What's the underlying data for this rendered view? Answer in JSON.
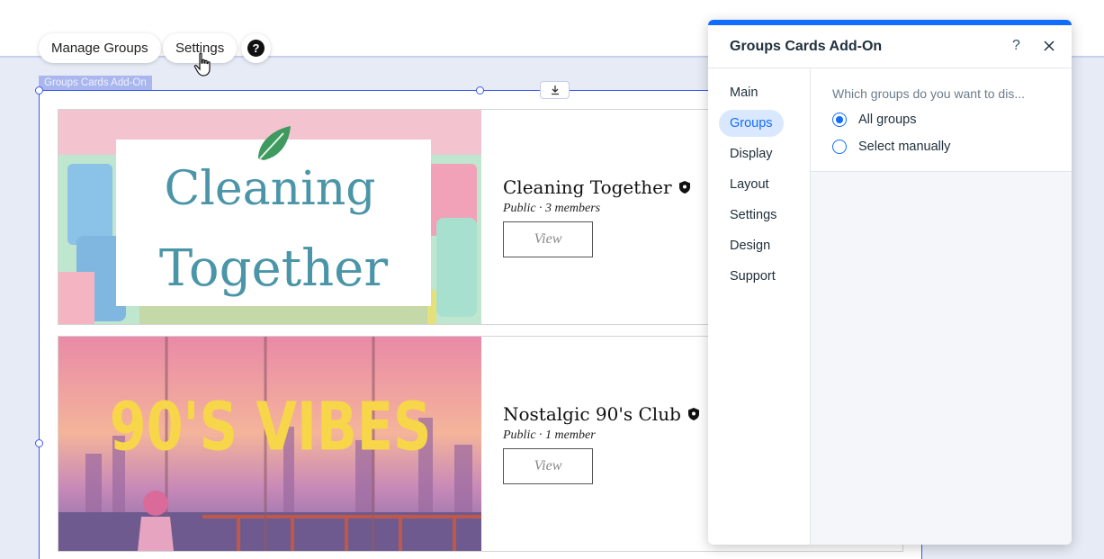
{
  "toolbar": {
    "manage_groups": "Manage Groups",
    "settings": "Settings",
    "help": "?"
  },
  "component": {
    "label": "Groups Cards Add-On"
  },
  "groups": [
    {
      "title": "Cleaning Together",
      "meta": "Public · 3 members",
      "view_label": "View",
      "image_text_line1": "Cleaning",
      "image_text_line2": "Together"
    },
    {
      "title": "Nostalgic 90's Club",
      "meta": "Public · 1 member",
      "view_label": "View",
      "image_text_line1": "90'S VIBES"
    }
  ],
  "panel": {
    "title": "Groups Cards Add-On",
    "help": "?",
    "nav": [
      "Main",
      "Groups",
      "Display",
      "Layout",
      "Settings",
      "Design",
      "Support"
    ],
    "active_nav": "Groups",
    "question": "Which groups do you want to dis...",
    "options": [
      {
        "label": "All groups",
        "checked": true
      },
      {
        "label": "Select manually",
        "checked": false
      }
    ]
  },
  "colors": {
    "accent": "#116dff",
    "selection": "#3a5af0",
    "canvas": "#e6ebf5"
  }
}
